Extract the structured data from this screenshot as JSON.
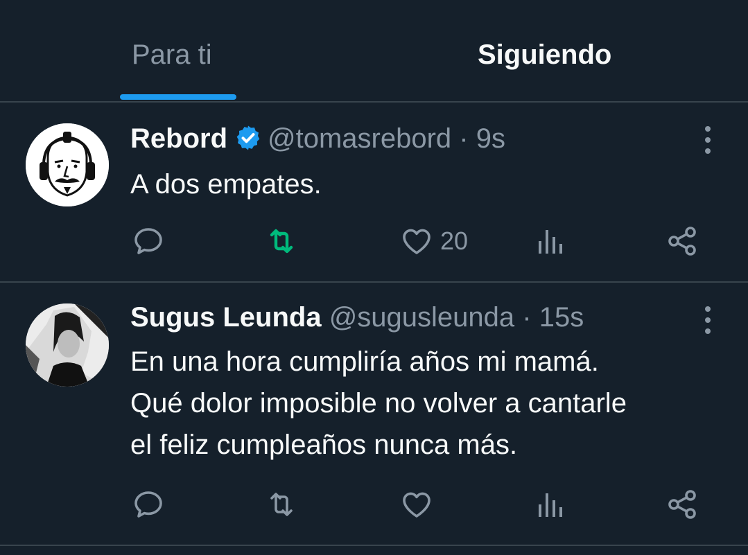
{
  "tabs": [
    {
      "label": "Para ti"
    },
    {
      "label": "Siguiendo"
    }
  ],
  "tweets": [
    {
      "name": "Rebord",
      "handle": "@tomasrebord",
      "separator": "·",
      "time": "9s",
      "verified": true,
      "avatar_icon": "cartoon-face-headphones",
      "lines": [
        "A dos empates."
      ],
      "like_count": "20",
      "retweeted": true
    },
    {
      "name": "Sugus Leunda",
      "handle": "@sugusleunda",
      "separator": "·",
      "time": "15s",
      "verified": false,
      "avatar_icon": "photo-woman",
      "lines": [
        "En una hora cumpliría años mi mamá.",
        "Qué dolor imposible no volver a cantarle",
        "el feliz cumpleaños nunca más."
      ],
      "like_count": "",
      "retweeted": false
    }
  ],
  "colors": {
    "background": "#15202b",
    "text_primary": "#f7f9f9",
    "text_secondary": "#8b98a5",
    "accent_blue": "#1d9bf0",
    "retweet_green": "#00ba7c",
    "divider": "#38444d"
  },
  "icons": {
    "reply": "reply-icon",
    "retweet": "retweet-icon",
    "like": "heart-icon",
    "views": "views-icon",
    "share": "share-icon",
    "more": "more-icon",
    "verified": "verified-badge-icon"
  }
}
